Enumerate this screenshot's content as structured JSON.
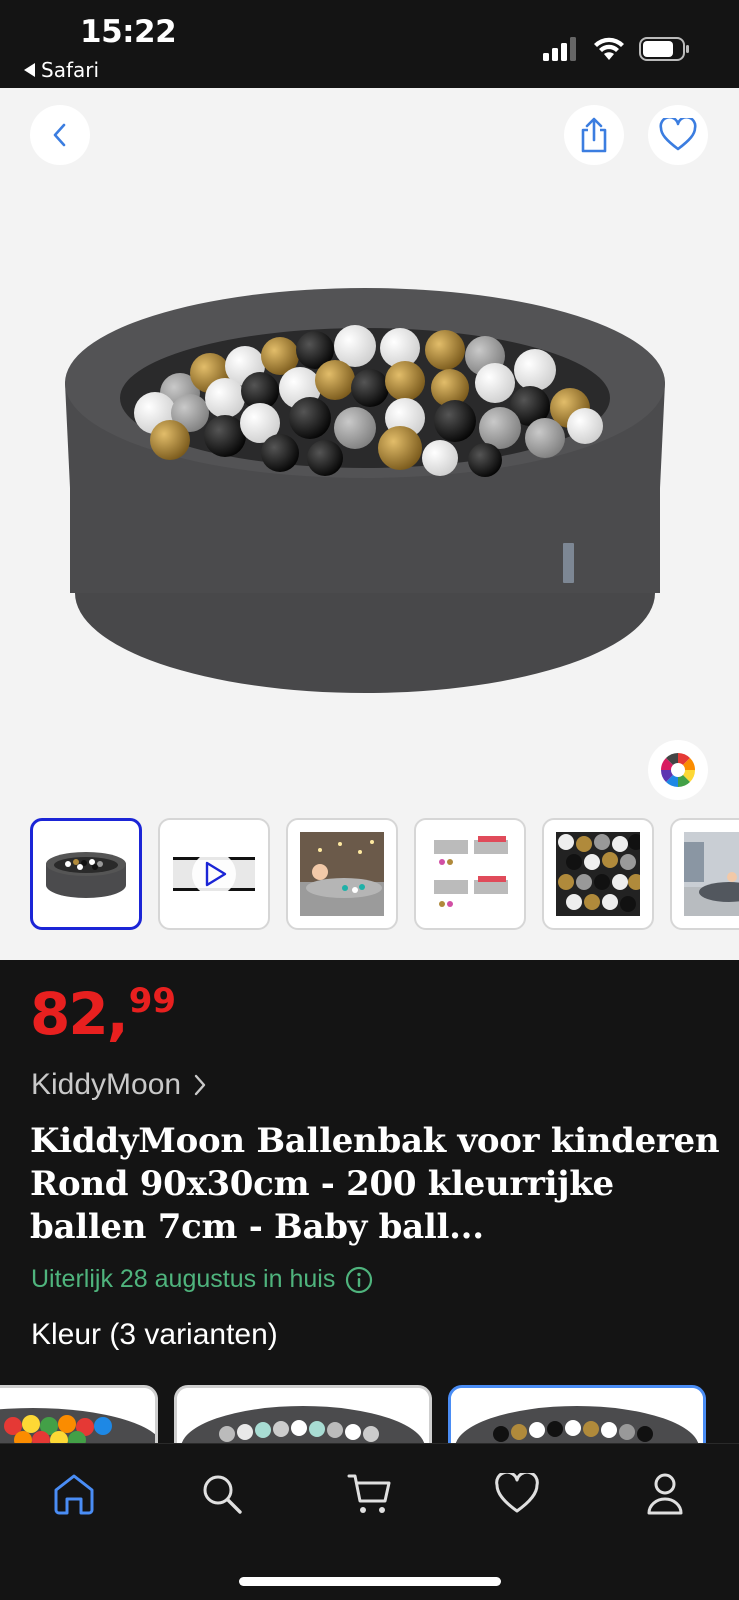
{
  "status_bar": {
    "time": "15:22",
    "back_app": "Safari"
  },
  "nav": {
    "icons": [
      "chevron-left-icon",
      "share-icon",
      "heart-icon",
      "color-wheel-icon"
    ]
  },
  "gallery": {
    "thumbnails": [
      {
        "kind": "image",
        "selected": true
      },
      {
        "kind": "video",
        "selected": false
      },
      {
        "kind": "image",
        "selected": false
      },
      {
        "kind": "image",
        "selected": false
      },
      {
        "kind": "image",
        "selected": false
      },
      {
        "kind": "image",
        "selected": false
      }
    ]
  },
  "product": {
    "price_euros": "82",
    "price_comma": ",",
    "price_cents": "99",
    "brand": "KiddyMoon",
    "title": "KiddyMoon Ballenbak voor kinderen Rond 90x30cm - 200 kleurrijke ballen 7cm - Baby ball...",
    "delivery": "Uiterlijk 28 augustus in huis",
    "variants_label": "Kleur (3 varianten)"
  },
  "colors": {
    "price": "#e8201f",
    "delivery": "#4fb47d",
    "accent": "#1b25d6",
    "tab_active": "#4a8df5",
    "background": "#141414"
  },
  "tabbar": {
    "items": [
      {
        "icon": "home-icon",
        "active": true
      },
      {
        "icon": "search-icon",
        "active": false
      },
      {
        "icon": "cart-icon",
        "active": false
      },
      {
        "icon": "heart-icon",
        "active": false
      },
      {
        "icon": "profile-icon",
        "active": false
      }
    ]
  }
}
